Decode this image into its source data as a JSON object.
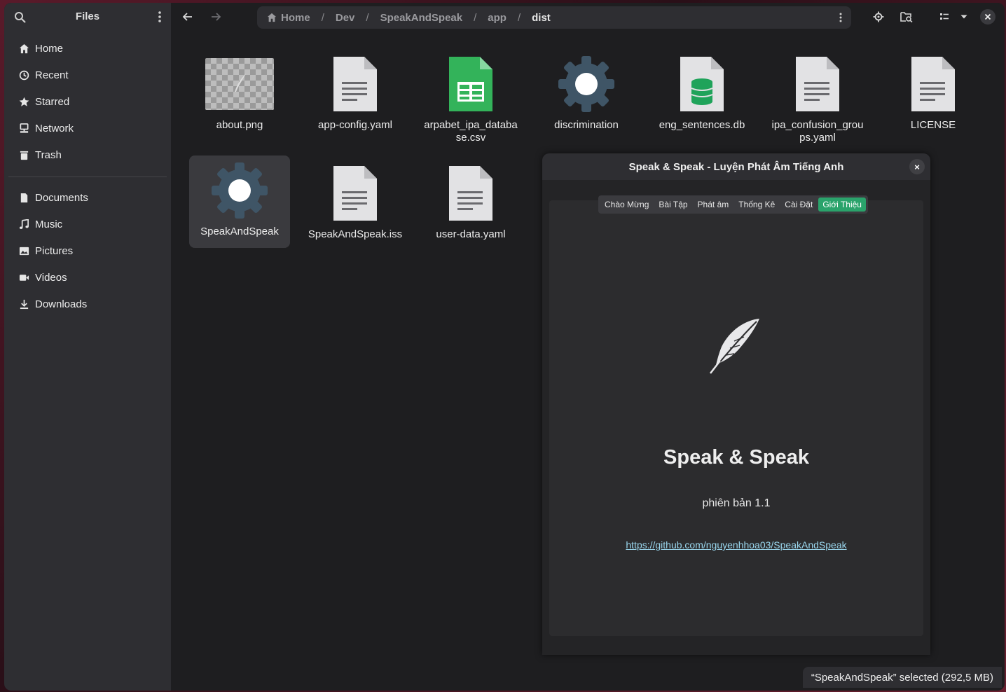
{
  "sidebar": {
    "title": "Files",
    "places": [
      {
        "label": "Home",
        "icon": "home-icon"
      },
      {
        "label": "Recent",
        "icon": "clock-icon"
      },
      {
        "label": "Starred",
        "icon": "star-icon"
      },
      {
        "label": "Network",
        "icon": "network-icon"
      },
      {
        "label": "Trash",
        "icon": "trash-icon"
      }
    ],
    "bookmarks": [
      {
        "label": "Documents",
        "icon": "document-icon"
      },
      {
        "label": "Music",
        "icon": "music-icon"
      },
      {
        "label": "Pictures",
        "icon": "picture-icon"
      },
      {
        "label": "Videos",
        "icon": "video-icon"
      },
      {
        "label": "Downloads",
        "icon": "download-icon"
      }
    ]
  },
  "pathbar": {
    "crumbs": [
      "Home",
      "Dev",
      "SpeakAndSpeak",
      "app",
      "dist"
    ],
    "separator": "/"
  },
  "files": [
    {
      "name": "about.png",
      "type": "image"
    },
    {
      "name": "app-config.yaml",
      "type": "text"
    },
    {
      "name": "arpabet_ipa_database.csv",
      "type": "spreadsheet"
    },
    {
      "name": "discrimination",
      "type": "executable"
    },
    {
      "name": "eng_sentences.db",
      "type": "database"
    },
    {
      "name": "ipa_confusion_groups.yaml",
      "type": "text"
    },
    {
      "name": "LICENSE",
      "type": "text"
    },
    {
      "name": "SpeakAndSpeak",
      "type": "executable",
      "selected": true
    },
    {
      "name": "SpeakAndSpeak.iss",
      "type": "text"
    },
    {
      "name": "user-data.yaml",
      "type": "text"
    }
  ],
  "status": "“SpeakAndSpeak” selected  (292,5 MB)",
  "dialog": {
    "title": "Speak & Speak - Luyện Phát Âm Tiếng Anh",
    "close": "×",
    "tabs": [
      "Chào Mừng",
      "Bài Tập",
      "Phát âm",
      "Thống Kê",
      "Cài Đặt",
      "Giới Thiệu"
    ],
    "active_tab": "Giới Thiệu",
    "app_name": "Speak & Speak",
    "version": "phiên bản 1.1",
    "link": "https://github.com/nguyenhhoa03/SpeakAndSpeak"
  },
  "colors": {
    "accent_green": "#2aa36b",
    "spreadsheet_green": "#33b35a",
    "gear": "#3f5566",
    "link": "#9ad7ee"
  }
}
